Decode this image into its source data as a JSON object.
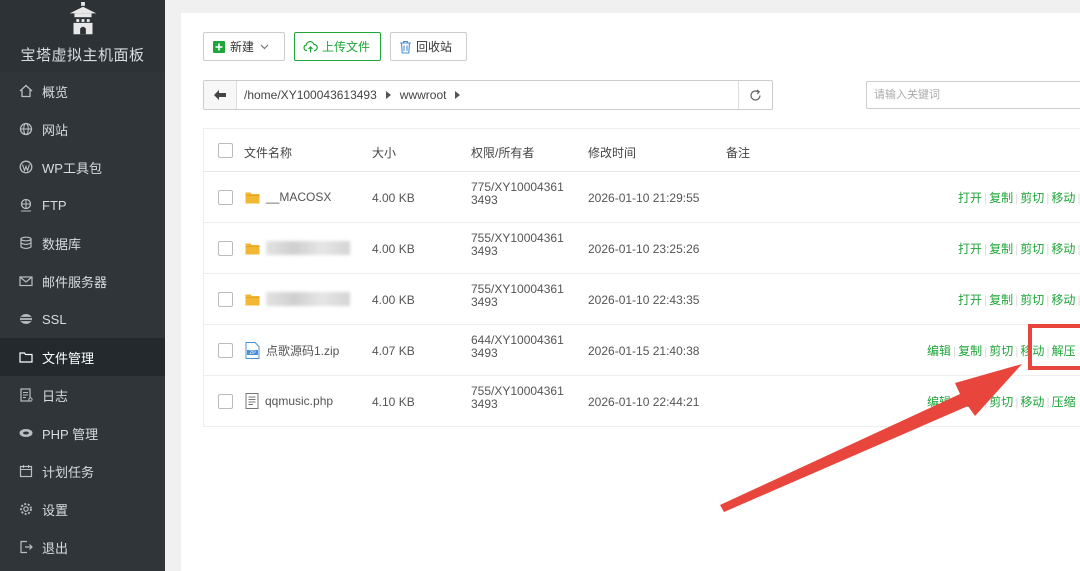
{
  "sidebar": {
    "brand": "宝塔虚拟主机面板",
    "items": [
      {
        "label": "概览",
        "icon": "home-icon",
        "active": false
      },
      {
        "label": "网站",
        "icon": "globe-icon",
        "active": false
      },
      {
        "label": "WP工具包",
        "icon": "wordpress-icon",
        "active": false
      },
      {
        "label": "FTP",
        "icon": "ftp-icon",
        "active": false
      },
      {
        "label": "数据库",
        "icon": "database-icon",
        "active": false
      },
      {
        "label": "邮件服务器",
        "icon": "mail-icon",
        "active": false
      },
      {
        "label": "SSL",
        "icon": "ssl-icon",
        "active": false
      },
      {
        "label": "文件管理",
        "icon": "folder-icon",
        "active": true
      },
      {
        "label": "日志",
        "icon": "log-icon",
        "active": false
      },
      {
        "label": "PHP 管理",
        "icon": "php-icon",
        "active": false
      },
      {
        "label": "计划任务",
        "icon": "calendar-icon",
        "active": false
      },
      {
        "label": "设置",
        "icon": "gear-icon",
        "active": false
      },
      {
        "label": "退出",
        "icon": "logout-icon",
        "active": false
      }
    ]
  },
  "toolbar": {
    "new_label": "新建",
    "upload_label": "上传文件",
    "recycle_label": "回收站"
  },
  "path": {
    "segments": [
      "/home/XY100043613493",
      "wwwroot"
    ]
  },
  "search": {
    "placeholder": "请输入关键词"
  },
  "table": {
    "headers": {
      "name": "文件名称",
      "size": "大小",
      "perm": "权限/所有者",
      "mtime": "修改时间",
      "note": "备注"
    },
    "rows": [
      {
        "type": "folder",
        "name": "__MACOSX",
        "size": "4.00 KB",
        "perm_line1": "775/XY10004361",
        "perm_line2": "3493",
        "mtime": "2026-01-10 21:29:55",
        "ops": [
          "打开",
          "复制",
          "剪切",
          "移动"
        ]
      },
      {
        "type": "folder",
        "name": "",
        "size": "4.00 KB",
        "perm_line1": "755/XY10004361",
        "perm_line2": "3493",
        "mtime": "2026-01-10 23:25:26",
        "ops": [
          "打开",
          "复制",
          "剪切",
          "移动"
        ]
      },
      {
        "type": "folder",
        "name": "",
        "size": "4.00 KB",
        "perm_line1": "755/XY10004361",
        "perm_line2": "3493",
        "mtime": "2026-01-10 22:43:35",
        "ops": [
          "打开",
          "复制",
          "剪切",
          "移动"
        ]
      },
      {
        "type": "zip",
        "name": "点歌源码1.zip",
        "size": "4.07 KB",
        "perm_line1": "644/XY10004361",
        "perm_line2": "3493",
        "mtime": "2026-01-15 21:40:38",
        "ops": [
          "编辑",
          "复制",
          "剪切",
          "移动",
          "解压"
        ]
      },
      {
        "type": "file",
        "name": "qqmusic.php",
        "size": "4.10 KB",
        "perm_line1": "755/XY10004361",
        "perm_line2": "3493",
        "mtime": "2026-01-10 22:44:21",
        "ops": [
          "编辑",
          "复制",
          "剪切",
          "移动",
          "压缩"
        ]
      }
    ]
  },
  "colors": {
    "accent": "#20a53a",
    "sidebar_bg": "#2f3539",
    "annotation": "#e8453c"
  }
}
